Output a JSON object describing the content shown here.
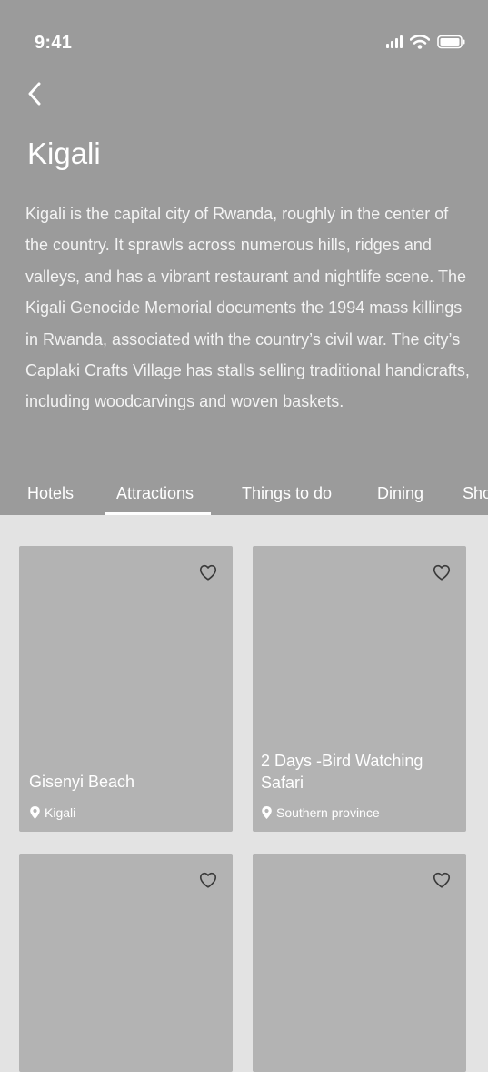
{
  "status_bar": {
    "time": "9:41",
    "icons": [
      "cellular-signal-icon",
      "wifi-icon",
      "battery-icon"
    ]
  },
  "header": {
    "back_icon": "chevron-left-icon",
    "title": "Kigali",
    "description": "Kigali is the capital city of Rwanda, roughly in the center of the country. It sprawls across numerous hills, ridges and valleys, and has a vibrant restaurant and nightlife scene. The Kigali Genocide Memorial documents the 1994 mass killings in Rwanda, associated with the country’s civil war. The city’s Caplaki Crafts Village has stalls selling traditional handicrafts, including woodcarvings and woven baskets."
  },
  "tabs": [
    {
      "label": "Hotels",
      "active": false
    },
    {
      "label": "Attractions",
      "active": true
    },
    {
      "label": "Things to do",
      "active": false
    },
    {
      "label": "Dining",
      "active": false
    },
    {
      "label": "Sho",
      "active": false
    }
  ],
  "cards": [
    {
      "title": "Gisenyi Beach",
      "location": "Kigali",
      "icon": "heart-outline-icon"
    },
    {
      "title": "2 Days -Bird Watching Safari",
      "location": "Southern province",
      "icon": "heart-outline-icon"
    },
    {
      "title": "",
      "location": "",
      "icon": "heart-outline-icon"
    },
    {
      "title": "",
      "location": "",
      "icon": "heart-outline-icon"
    }
  ],
  "colors": {
    "header_bg": "#9b9b9b",
    "page_bg": "#e3e3e3",
    "card_bg": "#b3b3b3",
    "text_on_dark": "#ffffff",
    "icon_dark": "#3a3a3a"
  }
}
